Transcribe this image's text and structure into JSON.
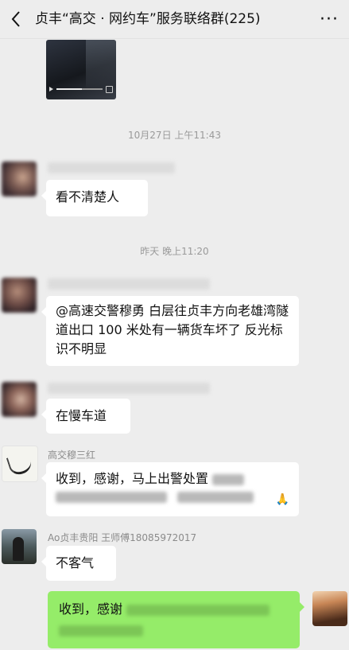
{
  "header": {
    "title": "贞丰“高交 · 网约车”服务联络群(225)",
    "back_icon": "chevron-left-icon",
    "more_icon": "more-dots-icon",
    "more_label": "···"
  },
  "timestamps": {
    "first": "10月27日 上午11:43",
    "second": "昨天 晚上11:20"
  },
  "messages": [
    {
      "id": "m1",
      "text": "看不清楚人"
    },
    {
      "id": "m2",
      "text": "@高速交警穆勇  白层往贞丰方向老雄湾隧道出口 100 米处有一辆货车坏了 反光标识不明显"
    },
    {
      "id": "m3",
      "text": "在慢车道"
    },
    {
      "id": "m4",
      "sender": "高交穆三红",
      "text": "收到，感谢，马上出警处置",
      "emoji": "🙏"
    },
    {
      "id": "m5",
      "sender": "Ao贞丰贵阳 王师傅18085972017",
      "text": "不客气"
    },
    {
      "id": "m6",
      "text": "收到，感谢"
    }
  ],
  "colors": {
    "background": "#ededed",
    "self_bubble": "#95ec69",
    "other_bubble": "#ffffff"
  }
}
